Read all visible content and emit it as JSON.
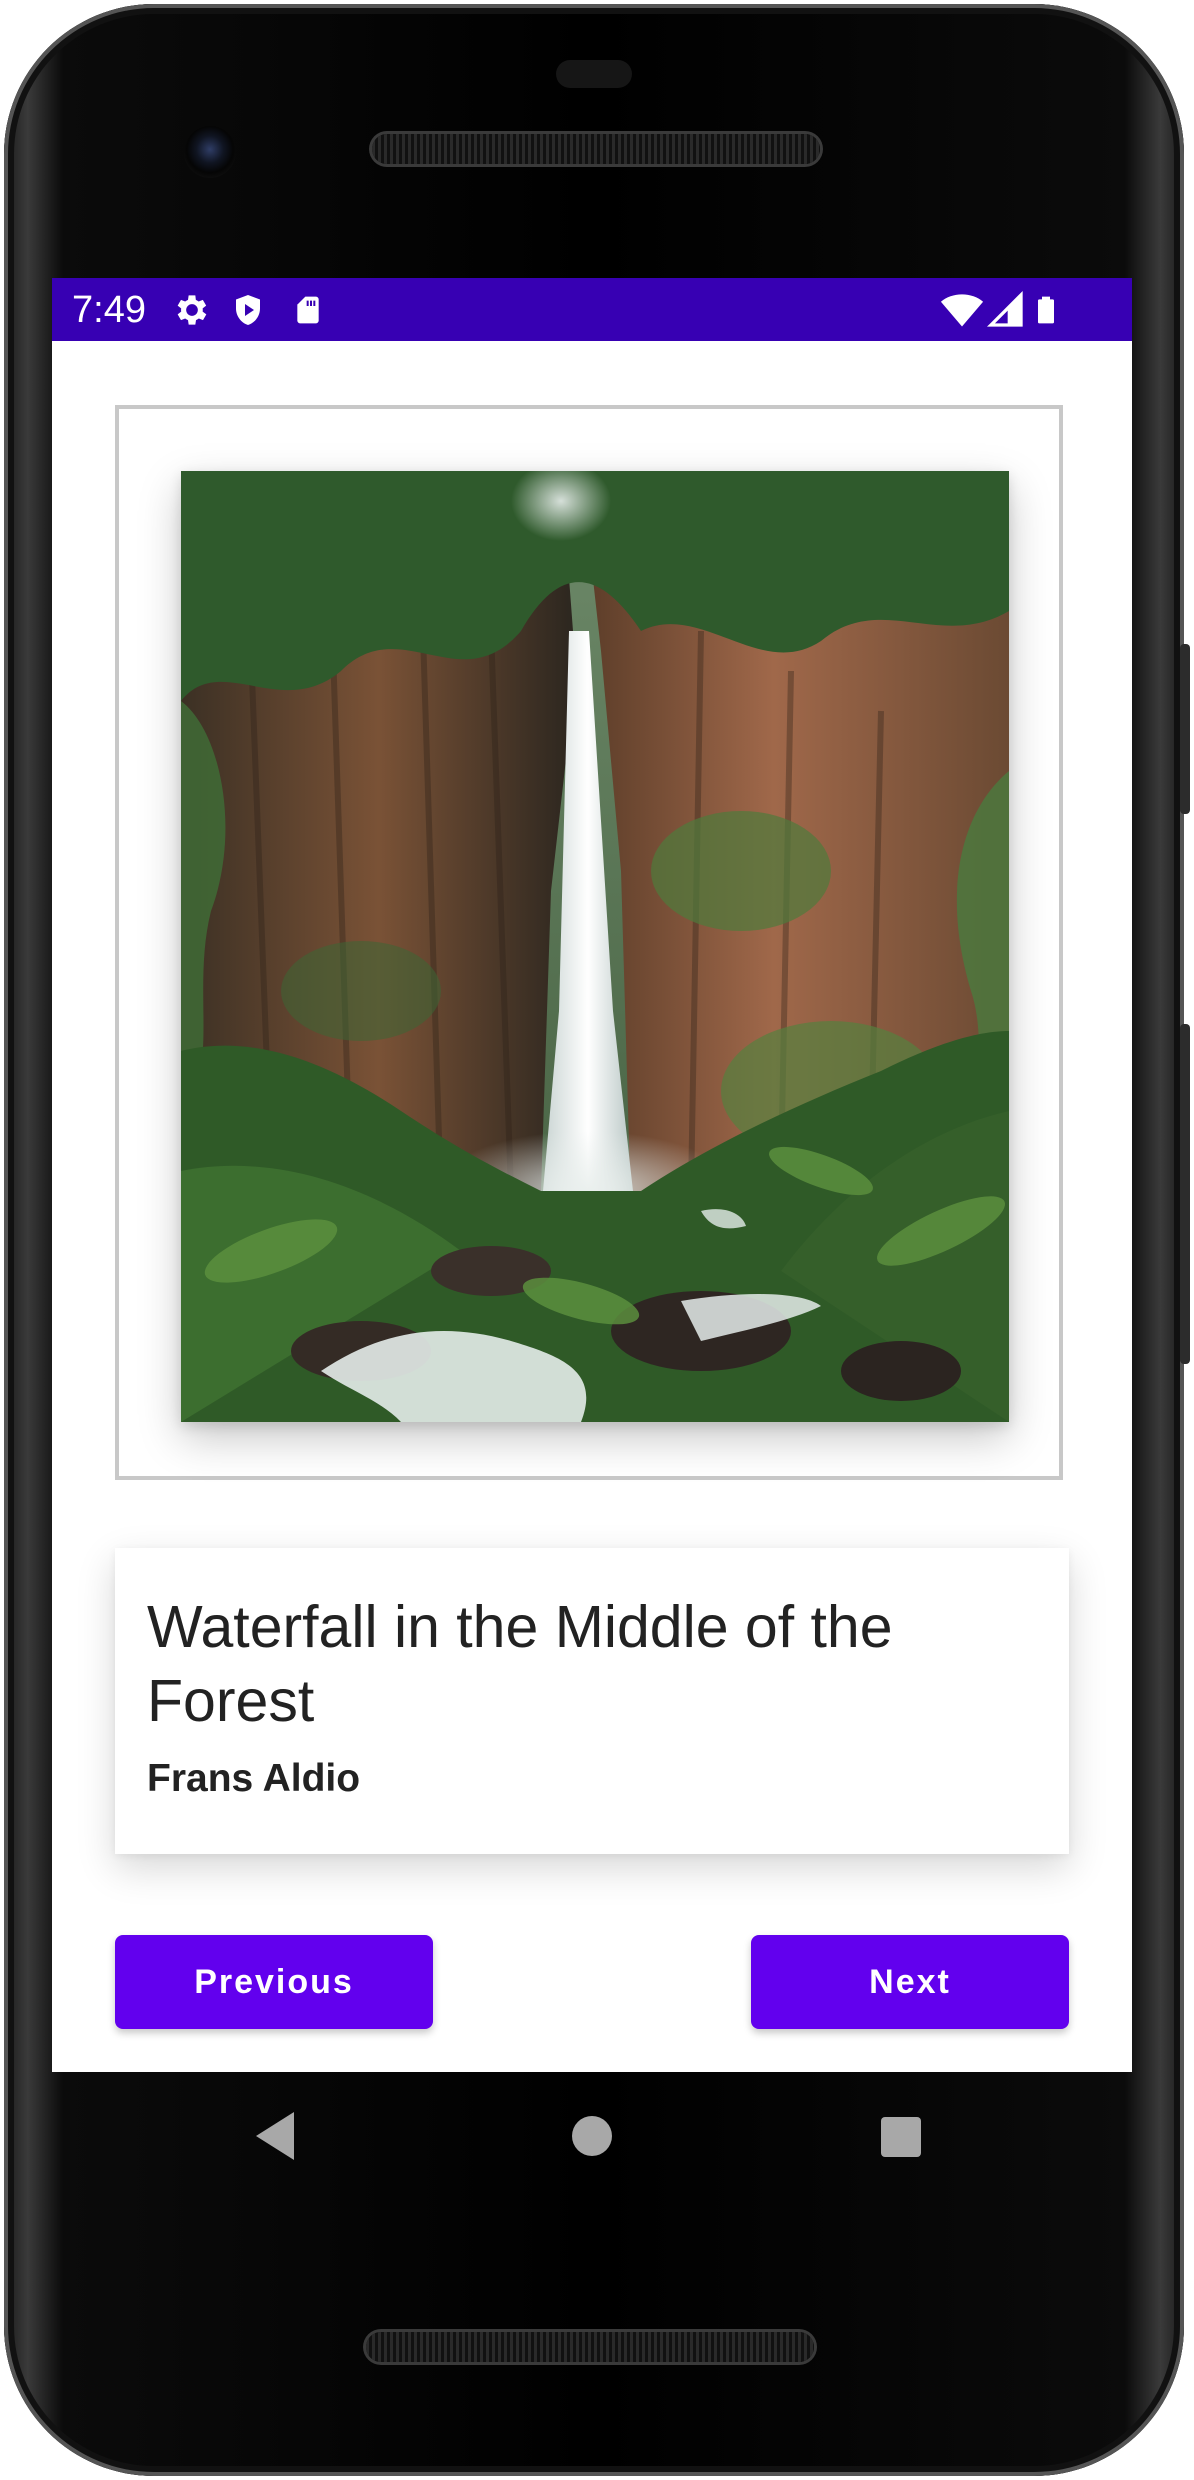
{
  "status_bar": {
    "time": "7:49",
    "color": "#3700b3",
    "left_icons": [
      "gear-icon",
      "shield-play-icon",
      "sd-card-icon"
    ],
    "right_icons": [
      "wifi-icon",
      "cell-signal-icon",
      "battery-icon"
    ]
  },
  "artwork": {
    "title": "Waterfall in the Middle of the Forest",
    "artist": "Frans Aldio",
    "image_description_icon": "waterfall-photo"
  },
  "buttons": {
    "previous_label": "Previous",
    "next_label": "Next",
    "color": "#6200ee"
  },
  "navigation_bar": {
    "icons": [
      "back-icon",
      "home-icon",
      "recents-icon"
    ]
  }
}
